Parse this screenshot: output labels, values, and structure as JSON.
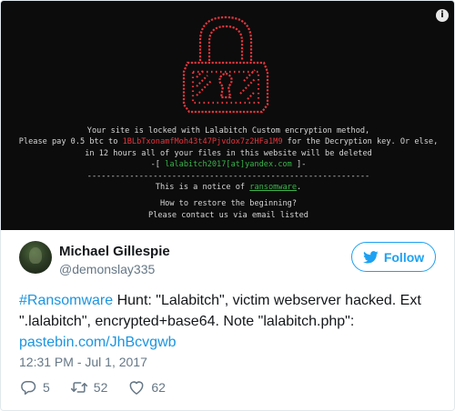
{
  "ransom_note": {
    "line1": "Your site is locked with Lalabitch Custom encryption method,",
    "line2_pre": "Please pay 0.5 btc to ",
    "btc_address": "1BLbTxonamfMoh43t47Pjvdox7z2HFa1M9",
    "line2_post": " for the Decryption key. Or else,",
    "line3": "in 12 hours all of your files in this website will be deleted",
    "email_open": "-[ ",
    "email": "lalabitch2017[at]yandex.com",
    "email_close": " ]-",
    "separator": "------------------------------------------------------------",
    "line5_pre": "This is a notice of ",
    "line5_word": "ransomware",
    "line5_post": ".",
    "line6": "How to restore the beginning?",
    "line7": "Please contact us via email listed"
  },
  "tweet": {
    "author_name": "Michael Gillespie",
    "author_handle": "@demonslay335",
    "follow_label": "Follow",
    "text_hashtag": "#Ransomware",
    "text_body": " Hunt: \"Lalabitch\", victim webserver hacked. Ext \".lalabitch\", encrypted+base64. Note \"lalabitch.php\": ",
    "text_link": "pastebin.com/JhBcvgwb",
    "timestamp": "12:31 PM - Jul 1, 2017",
    "replies": "5",
    "retweets": "52",
    "likes": "62"
  },
  "icons": {
    "info": "info-icon",
    "follow": "twitter-bird-icon",
    "reply": "reply-icon",
    "retweet": "retweet-icon",
    "like": "heart-icon"
  },
  "colors": {
    "ransom_background": "#0c0c0c",
    "lock_red": "#e8353d",
    "notice_text": "#d7d7d7",
    "email_green": "#39b54a",
    "twitter_blue": "#1da1f2",
    "link_blue": "#1b95e0",
    "muted_gray": "#657786"
  }
}
